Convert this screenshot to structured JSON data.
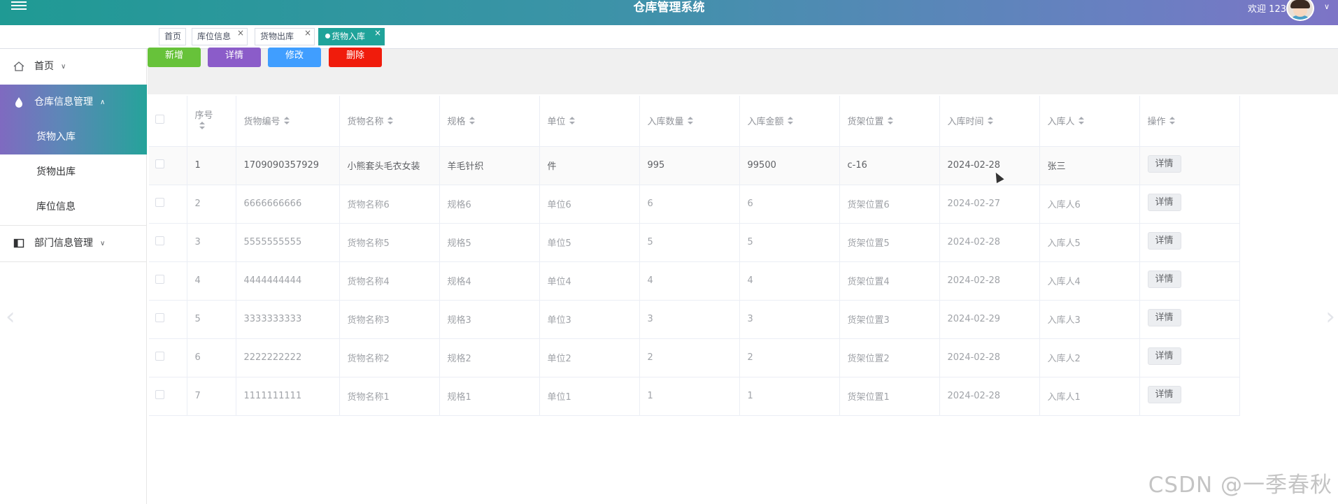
{
  "header": {
    "title": "仓库管理系统",
    "welcome": "欢迎 123"
  },
  "tabs": [
    {
      "label": "首页",
      "closable": false,
      "active": false
    },
    {
      "label": "库位信息",
      "closable": true,
      "active": false
    },
    {
      "label": "货物出库",
      "closable": true,
      "active": false
    },
    {
      "label": "货物入库",
      "closable": true,
      "active": true
    }
  ],
  "tab_close": "×",
  "sidebar": {
    "home": "首页",
    "warehouse": "仓库信息管理",
    "warehouse_children": [
      "货物入库",
      "货物出库",
      "库位信息"
    ],
    "department": "部门信息管理"
  },
  "toolbar": {
    "add": "新增",
    "detail": "详情",
    "edit": "修改",
    "delete": "删除",
    "colors": {
      "add": "#67c23a",
      "detail": "#8b5cc9",
      "edit": "#409eff",
      "delete": "#f01c0c"
    }
  },
  "table": {
    "columns": [
      "序号",
      "货物编号",
      "货物名称",
      "规格",
      "单位",
      "入库数量",
      "入库金额",
      "货架位置",
      "入库时间",
      "入库人",
      "操作"
    ],
    "rows": [
      [
        "1",
        "1709090357929",
        "小熊套头毛衣女装",
        "羊毛针织",
        "件",
        "995",
        "99500",
        "c-16",
        "2024-02-28",
        "张三"
      ],
      [
        "2",
        "6666666666",
        "货物名称6",
        "规格6",
        "单位6",
        "6",
        "6",
        "货架位置6",
        "2024-02-27",
        "入库人6"
      ],
      [
        "3",
        "5555555555",
        "货物名称5",
        "规格5",
        "单位5",
        "5",
        "5",
        "货架位置5",
        "2024-02-28",
        "入库人5"
      ],
      [
        "4",
        "4444444444",
        "货物名称4",
        "规格4",
        "单位4",
        "4",
        "4",
        "货架位置4",
        "2024-02-28",
        "入库人4"
      ],
      [
        "5",
        "3333333333",
        "货物名称3",
        "规格3",
        "单位3",
        "3",
        "3",
        "货架位置3",
        "2024-02-29",
        "入库人3"
      ],
      [
        "6",
        "2222222222",
        "货物名称2",
        "规格2",
        "单位2",
        "2",
        "2",
        "货架位置2",
        "2024-02-28",
        "入库人2"
      ],
      [
        "7",
        "1111111111",
        "货物名称1",
        "规格1",
        "单位1",
        "1",
        "1",
        "货架位置1",
        "2024-02-28",
        "入库人1"
      ]
    ],
    "row_action": "详情"
  },
  "icons": {
    "menu": "hamburger-menu-icon",
    "home": "house-icon",
    "warehouse": "drop-icon",
    "department": "panel-icon"
  },
  "watermark": "CSDN @一季春秋",
  "pager": {
    "prev": "‹",
    "next": "›"
  }
}
